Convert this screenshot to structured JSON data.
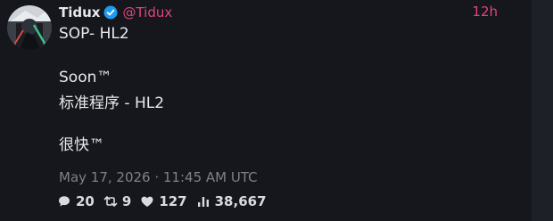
{
  "author": {
    "name": "Tidux",
    "handle": "@Tidux",
    "verified": true
  },
  "post": {
    "time_ago": "12h",
    "lines": [
      "SOP- HL2",
      "Soon™",
      "标准程序 - HL2",
      "很快™"
    ],
    "timestamp": "May 17, 2026 · 11:45 AM UTC"
  },
  "stats": {
    "replies": "20",
    "reposts": "9",
    "likes": "127",
    "views": "38,667"
  },
  "icons": {
    "verified": "verified-badge-icon",
    "reply": "comment-icon",
    "repost": "repost-icon",
    "like": "heart-icon",
    "views": "bar-chart-icon"
  },
  "colors": {
    "background": "#15171c",
    "handle_accent": "#e0457b",
    "muted": "#7d828a",
    "verified": "#1d9bf0"
  }
}
